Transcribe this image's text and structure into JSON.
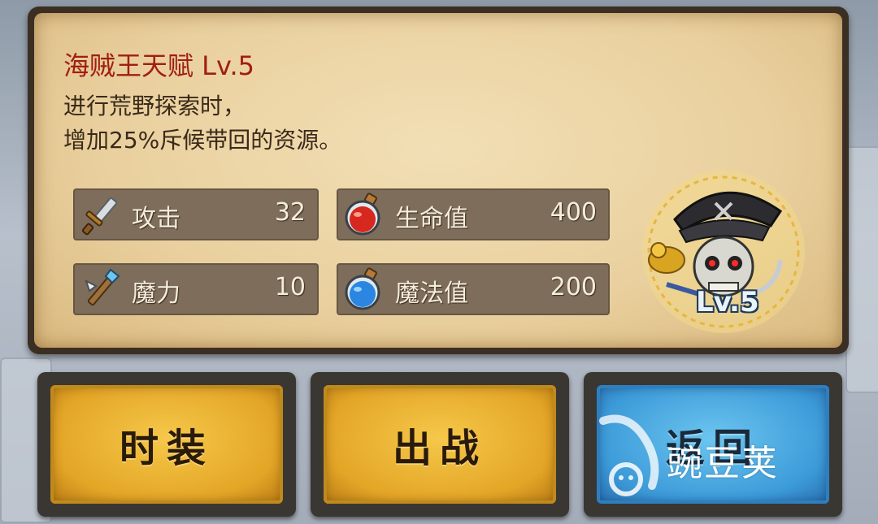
{
  "talent": {
    "title": "海贼王天赋 Lv.5",
    "description_line1": "进行荒野探索时，",
    "description_line2": "增加25%斥候带回的资源。",
    "level_badge": "Lv.5"
  },
  "stats": [
    {
      "label": "攻击",
      "value": "32",
      "icon": "sword-icon"
    },
    {
      "label": "生命值",
      "value": "400",
      "icon": "red-potion-icon"
    },
    {
      "label": "魔力",
      "value": "10",
      "icon": "magic-staff-icon"
    },
    {
      "label": "魔法值",
      "value": "200",
      "icon": "blue-potion-icon"
    }
  ],
  "buttons": {
    "costume": "时装",
    "battle": "出战",
    "back": "返回"
  },
  "watermark": {
    "text": "豌豆荚"
  },
  "colors": {
    "title": "#a01e12",
    "gold_button": "#e3a526",
    "blue_button": "#3c9ad8",
    "parchment": "#e9cf9d",
    "stat_bar": "#7d6d5a"
  }
}
